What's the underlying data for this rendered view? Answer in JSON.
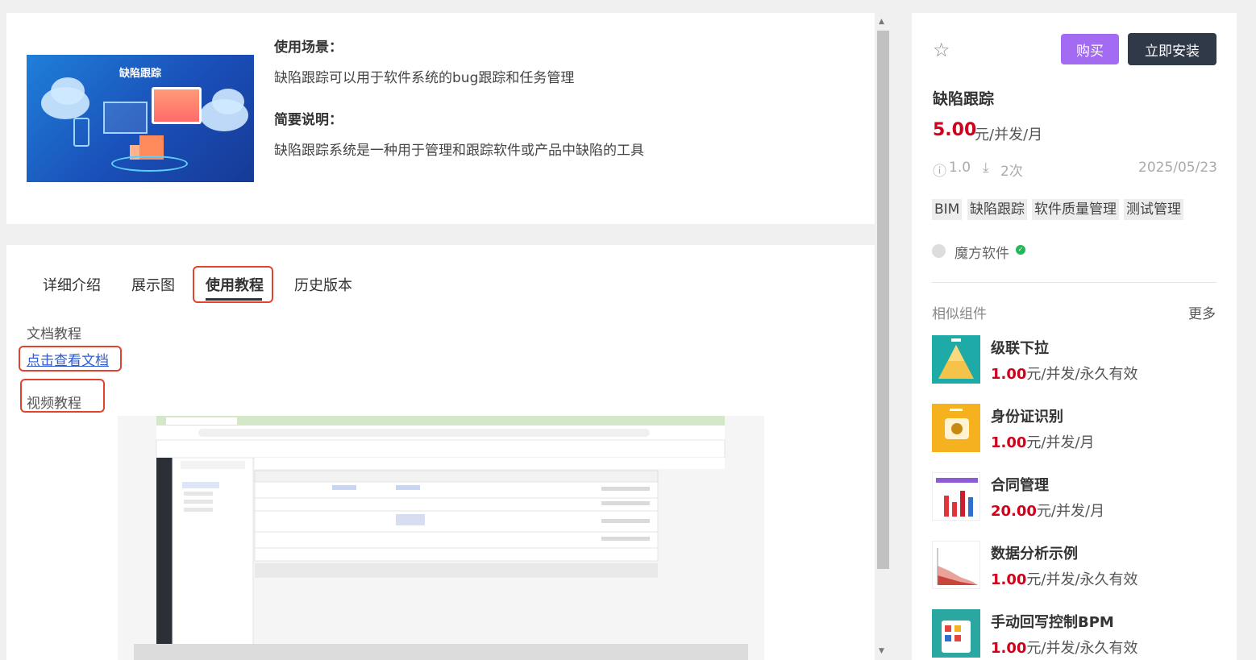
{
  "main": {
    "banner_title": "缺陷跟踪",
    "usage_label": "使用场景：",
    "usage_text": "缺陷跟踪可以用于软件系统的bug跟踪和任务管理",
    "summary_label": "简要说明：",
    "summary_text": "缺陷跟踪系统是一种用于管理和跟踪软件或产品中缺陷的工具",
    "tabs": [
      {
        "label": "详细介绍"
      },
      {
        "label": "展示图"
      },
      {
        "label": "使用教程"
      },
      {
        "label": "历史版本"
      }
    ],
    "active_tab": "使用教程",
    "doc_title": "文档教程",
    "doc_link": "点击查看文档",
    "video_title": "视频教程"
  },
  "sidebar": {
    "buy_label": "购买",
    "install_label": "立即安装",
    "product_name": "缺陷跟踪",
    "price": "5.00",
    "price_unit": "元/并发/月",
    "version": "1.0",
    "downloads": "2次",
    "date": "2025/05/23",
    "tags": [
      "BIM",
      "缺陷跟踪",
      "软件质量管理",
      "测试管理"
    ],
    "author": "魔方软件",
    "similar_title": "相似组件",
    "more_label": "更多",
    "similar": [
      {
        "name": "级联下拉",
        "price": "1.00",
        "unit": "元/并发/永久有效"
      },
      {
        "name": "身份证识别",
        "price": "1.00",
        "unit": "元/并发/月"
      },
      {
        "name": "合同管理",
        "price": "20.00",
        "unit": "元/并发/月"
      },
      {
        "name": "数据分析示例",
        "price": "1.00",
        "unit": "元/并发/永久有效"
      },
      {
        "name": "手动回写控制BPM",
        "price": "1.00",
        "unit": "元/并发/永久有效"
      }
    ]
  },
  "colors": {
    "accent_purple": "#a26bf2",
    "dark_button": "#2f3947",
    "price_red": "#d0021b",
    "highlight_red": "#e0442f",
    "link_blue": "#2d5bd1"
  }
}
